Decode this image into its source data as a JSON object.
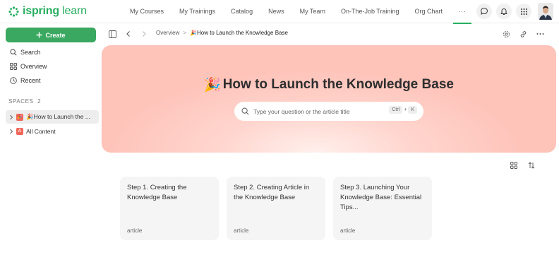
{
  "app": {
    "logo_name": "ispring",
    "logo_product": "learn",
    "brand_color": "#27ae60"
  },
  "nav": {
    "items": [
      {
        "label": "My Courses"
      },
      {
        "label": "My Trainings"
      },
      {
        "label": "Catalog"
      },
      {
        "label": "News"
      },
      {
        "label": "My Team"
      },
      {
        "label": "On-The-Job Training"
      },
      {
        "label": "Org Chart"
      },
      {
        "label": "···"
      }
    ],
    "active_index": 7
  },
  "header_icons": [
    "chat-icon",
    "bell-icon",
    "apps-grid-icon",
    "avatar"
  ],
  "sidebar": {
    "create_label": "Create",
    "items": [
      {
        "label": "Search",
        "icon": "search-icon"
      },
      {
        "label": "Overview",
        "icon": "grid-icon"
      },
      {
        "label": "Recent",
        "icon": "clock-icon"
      }
    ],
    "spaces_label": "SPACES",
    "spaces_count": "2",
    "spaces": [
      {
        "label": "🎉How to Launch the ...",
        "badge": "🎉",
        "active": true
      },
      {
        "label": "All Content",
        "badge": "A",
        "active": false
      }
    ]
  },
  "toolbar": {
    "breadcrumb_root": "Overview",
    "breadcrumb_separator": ">",
    "breadcrumb_current": "🎉How to Launch the Knowledge Base"
  },
  "hero": {
    "title_emoji": "🎉",
    "title": "How to Launch the Knowledge Base",
    "search_placeholder": "Type your question or the article title",
    "shortcut_key1": "Ctrl",
    "shortcut_plus": "+",
    "shortcut_key2": "K",
    "gradient_color": "#fec3b9"
  },
  "cards": [
    {
      "title": "Step 1. Creating the Knowledge Base",
      "type": "article"
    },
    {
      "title": "Step 2. Creating Article in the Knowledge Base",
      "type": "article"
    },
    {
      "title": "Step 3. Launching Your Knowledge Base: Essential Tips...",
      "type": "article"
    }
  ]
}
